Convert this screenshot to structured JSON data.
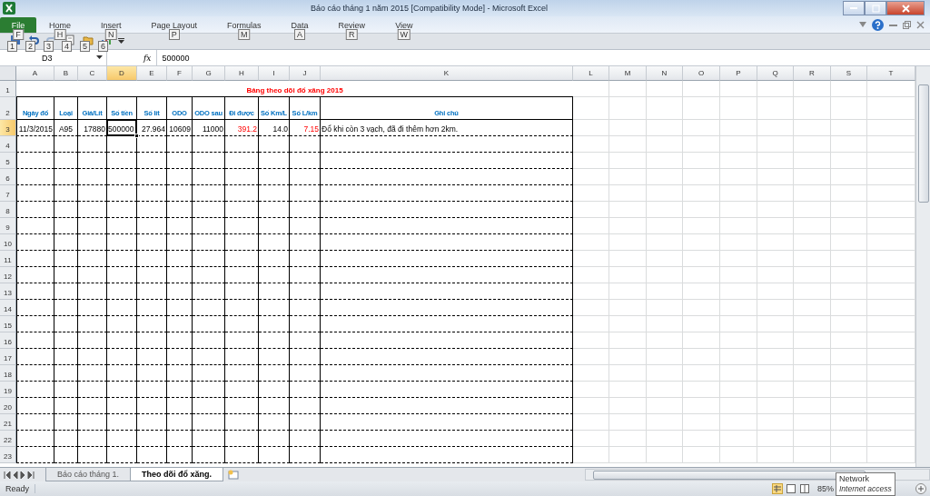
{
  "window": {
    "title": "Báo cáo tháng 1 năm 2015  [Compatibility Mode]  -  Microsoft Excel"
  },
  "ribbon_tabs": [
    {
      "kind": "file",
      "label": "File",
      "keytip": "F"
    },
    {
      "kind": "tab",
      "label": "Home",
      "keytip": "H"
    },
    {
      "kind": "tab",
      "label": "Insert",
      "keytip": "N"
    },
    {
      "kind": "tab",
      "label": "Page Layout",
      "keytip": "P"
    },
    {
      "kind": "tab",
      "label": "Formulas",
      "keytip": "M"
    },
    {
      "kind": "tab",
      "label": "Data",
      "keytip": "A"
    },
    {
      "kind": "tab",
      "label": "Review",
      "keytip": "R"
    },
    {
      "kind": "tab",
      "label": "View",
      "keytip": "W"
    }
  ],
  "quick_access": [
    {
      "kind": "save",
      "keytip": "1",
      "disabled": false
    },
    {
      "kind": "undo",
      "keytip": "2",
      "disabled": false
    },
    {
      "kind": "redo",
      "keytip": "3",
      "disabled": true
    },
    {
      "kind": "preview",
      "keytip": "4",
      "disabled": false
    },
    {
      "kind": "open",
      "keytip": "5",
      "disabled": false
    },
    {
      "kind": "chart",
      "keytip": "6",
      "disabled": false
    }
  ],
  "formula_bar": {
    "name_box": "D3",
    "fx_label": "fx",
    "value": "500000"
  },
  "columns": [
    {
      "label": "A",
      "selected": false
    },
    {
      "label": "B",
      "selected": false
    },
    {
      "label": "C",
      "selected": false
    },
    {
      "label": "D",
      "selected": true
    },
    {
      "label": "E",
      "selected": false
    },
    {
      "label": "F",
      "selected": false
    },
    {
      "label": "G",
      "selected": false
    },
    {
      "label": "H",
      "selected": false
    },
    {
      "label": "I",
      "selected": false
    },
    {
      "label": "J",
      "selected": false
    },
    {
      "label": "K",
      "selected": false
    },
    {
      "label": "L",
      "selected": false
    },
    {
      "label": "M",
      "selected": false
    },
    {
      "label": "N",
      "selected": false
    },
    {
      "label": "O",
      "selected": false
    },
    {
      "label": "P",
      "selected": false
    },
    {
      "label": "Q",
      "selected": false
    },
    {
      "label": "R",
      "selected": false
    },
    {
      "label": "S",
      "selected": false
    },
    {
      "label": "T",
      "selected": false
    }
  ],
  "row_headers": [
    {
      "label": "1",
      "selected": false
    },
    {
      "label": "2",
      "selected": false
    },
    {
      "label": "3",
      "selected": true
    },
    {
      "label": "4",
      "selected": false
    },
    {
      "label": "5",
      "selected": false
    },
    {
      "label": "6",
      "selected": false
    },
    {
      "label": "7",
      "selected": false
    },
    {
      "label": "8",
      "selected": false
    },
    {
      "label": "9",
      "selected": false
    },
    {
      "label": "10",
      "selected": false
    },
    {
      "label": "11",
      "selected": false
    },
    {
      "label": "12",
      "selected": false
    },
    {
      "label": "13",
      "selected": false
    },
    {
      "label": "14",
      "selected": false
    },
    {
      "label": "15",
      "selected": false
    },
    {
      "label": "16",
      "selected": false
    },
    {
      "label": "17",
      "selected": false
    },
    {
      "label": "18",
      "selected": false
    },
    {
      "label": "19",
      "selected": false
    },
    {
      "label": "20",
      "selected": false
    },
    {
      "label": "21",
      "selected": false
    },
    {
      "label": "22",
      "selected": false
    },
    {
      "label": "23",
      "selected": false
    }
  ],
  "sheet": {
    "title": "Bảng theo dõi đổ xăng 2015",
    "headers": [
      "Ngày đổ",
      "Loại",
      "Giá/Lít",
      "Số tiền",
      "Số lít",
      "ODO",
      "ODO sau",
      "Đi được",
      "Số Km/L",
      "Số L/km",
      "Ghi chú"
    ],
    "data_rows": [
      [
        {
          "text": "11/3/2015",
          "flagged": false,
          "selected": false
        },
        {
          "text": "A95",
          "flagged": false,
          "selected": false
        },
        {
          "text": "17880",
          "flagged": false,
          "selected": false
        },
        {
          "text": "500000",
          "flagged": false,
          "selected": true
        },
        {
          "text": "27.964",
          "flagged": false,
          "selected": false
        },
        {
          "text": "10609",
          "flagged": false,
          "selected": false
        },
        {
          "text": "11000",
          "flagged": false,
          "selected": false
        },
        {
          "text": "391.2",
          "flagged": true,
          "selected": false
        },
        {
          "text": "14.0",
          "flagged": false,
          "selected": false
        },
        {
          "text": "7.15",
          "flagged": true,
          "selected": false
        },
        {
          "text": "Đổ khi còn 3 vạch, đã đi thêm hơn 2km.",
          "flagged": false,
          "selected": false
        }
      ]
    ]
  },
  "sheet_tabs": [
    {
      "label": "Báo cáo tháng 1.",
      "selected": false
    },
    {
      "label": "Theo dõi đổ xăng.",
      "selected": true
    }
  ],
  "status_bar": {
    "status": "Ready",
    "zoom": "85%",
    "tooltip": {
      "title": "Network",
      "subtitle": "Internet access"
    }
  }
}
